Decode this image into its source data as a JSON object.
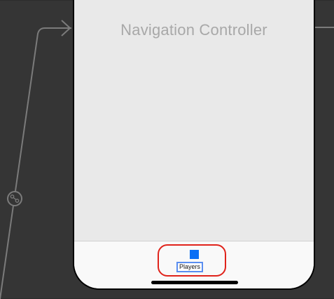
{
  "scene": {
    "title": "Navigation Controller"
  },
  "tab_bar": {
    "items": [
      {
        "label": "Players",
        "icon": "square-icon",
        "icon_color": "#0a6ff5"
      }
    ],
    "highlight_color": "#e0231b"
  },
  "colors": {
    "canvas_background": "#353535",
    "scene_background": "#e9e9e9",
    "segue_line": "#7b7b7b"
  }
}
